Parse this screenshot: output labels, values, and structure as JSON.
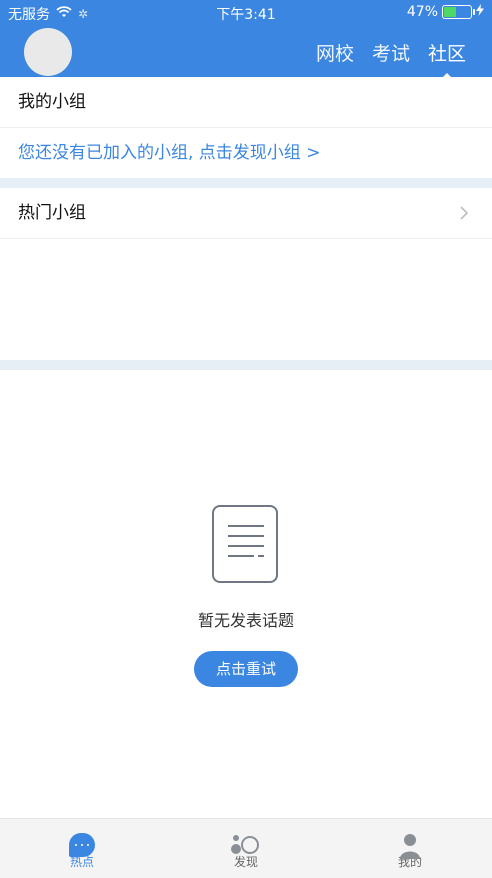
{
  "status": {
    "carrier": "无服务",
    "time": "下午3:41",
    "battery": "47%"
  },
  "header": {
    "tabs": [
      {
        "label": "网校",
        "active": false
      },
      {
        "label": "考试",
        "active": false
      },
      {
        "label": "社区",
        "active": true
      }
    ]
  },
  "my_group": {
    "title": "我的小组",
    "empty_link": "您还没有已加入的小组, 点击发现小组 >"
  },
  "hot_group": {
    "title": "热门小组"
  },
  "topics": {
    "empty_text": "暂无发表话题",
    "retry_label": "点击重试"
  },
  "tabbar": {
    "items": [
      {
        "label": "热点",
        "icon": "chat-bubble-icon",
        "active": true
      },
      {
        "label": "发现",
        "icon": "discover-icon",
        "active": false
      },
      {
        "label": "我的",
        "icon": "profile-icon",
        "active": false
      }
    ]
  },
  "colors": {
    "primary": "#3b86e0",
    "band": "#e6eff6",
    "battery_fill": "#4cd964"
  }
}
